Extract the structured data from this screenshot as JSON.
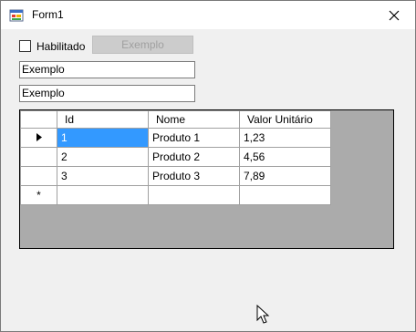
{
  "window": {
    "title": "Form1"
  },
  "form": {
    "checkbox_label": "Habilitado",
    "button_label": "Exemplo",
    "textbox1_value": "Exemplo",
    "textbox2_value": "Exemplo"
  },
  "grid": {
    "columns": [
      "Id",
      "Nome",
      "Valor Unitário"
    ],
    "rows": [
      {
        "id": "1",
        "nome": "Produto 1",
        "valor": "1,23"
      },
      {
        "id": "2",
        "nome": "Produto 2",
        "valor": "4,56"
      },
      {
        "id": "3",
        "nome": "Produto 3",
        "valor": "7,89"
      }
    ],
    "current_row_marker": "▶",
    "new_row_marker": "*"
  },
  "colors": {
    "selection": "#3399ff",
    "grid_background": "#ababab",
    "form_background": "#f0f0f0"
  },
  "icons": [
    "app-icon",
    "close-icon",
    "current-row-icon",
    "mouse-cursor-icon"
  ]
}
